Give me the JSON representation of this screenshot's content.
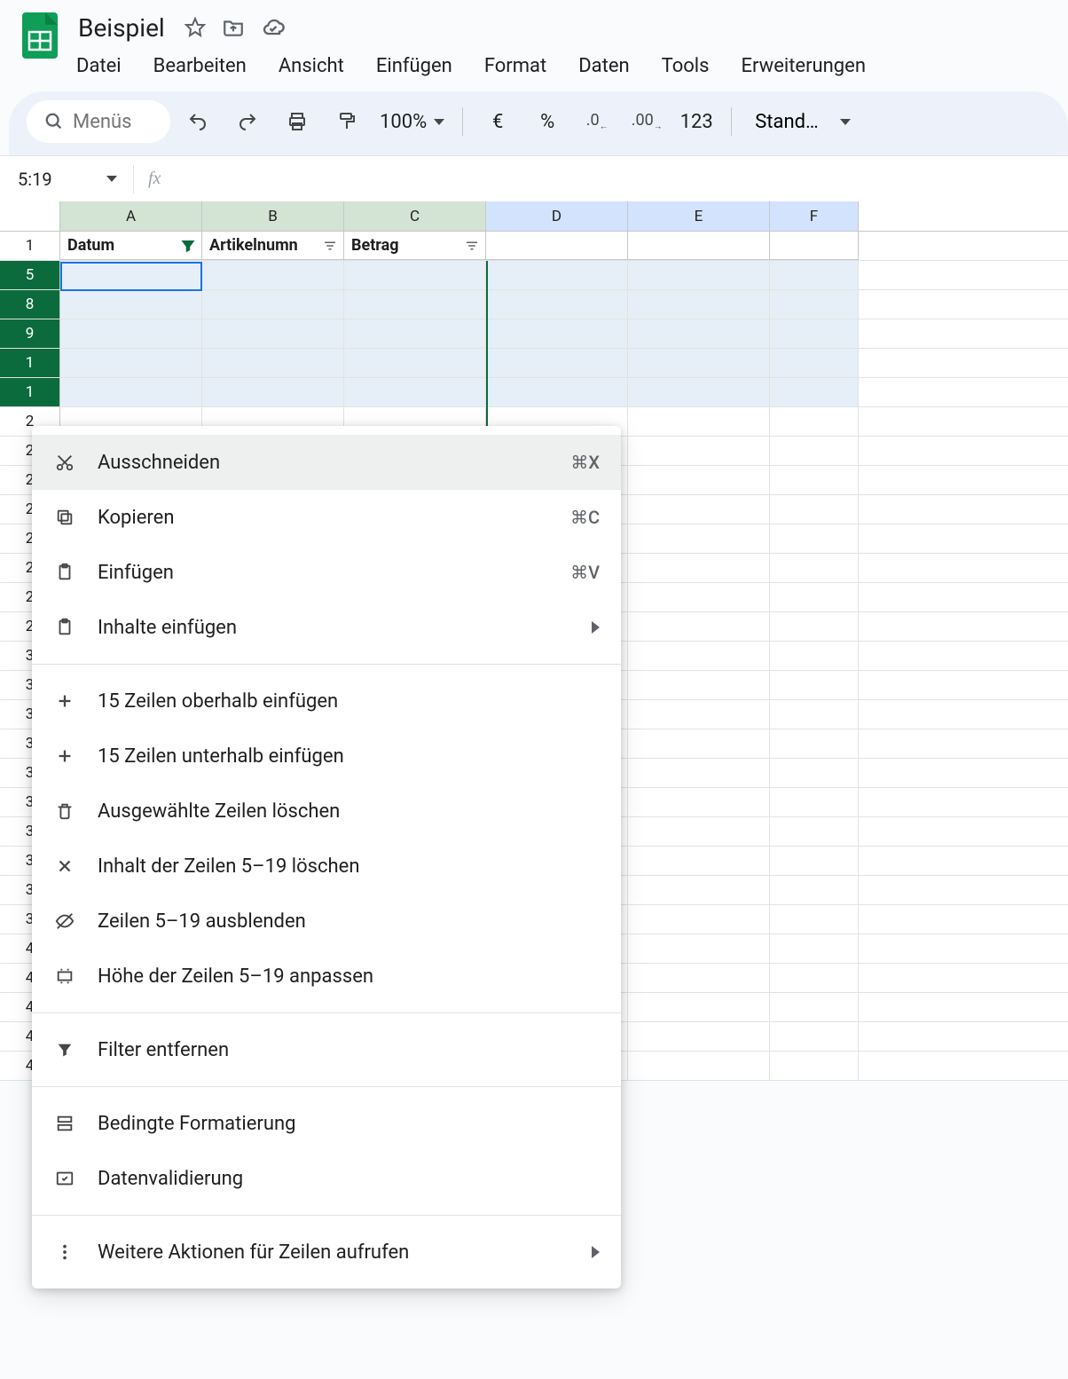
{
  "header": {
    "title": "Beispiel",
    "menu": [
      "Datei",
      "Bearbeiten",
      "Ansicht",
      "Einfügen",
      "Format",
      "Daten",
      "Tools",
      "Erweiterungen"
    ]
  },
  "toolbar": {
    "search_placeholder": "Menüs",
    "zoom": "100%",
    "currency": "€",
    "percent": "%",
    "dec_dec": ".0",
    "dec_inc": ".00",
    "numfmt": "123",
    "font": "Stand…"
  },
  "namebox": "5:19",
  "columns": [
    "A",
    "B",
    "C",
    "D",
    "E",
    "F"
  ],
  "header_cells": {
    "A": "Datum",
    "B": "Artikelnumn",
    "C": "Betrag"
  },
  "selected_row_heads": [
    "1",
    "5",
    "8",
    "9",
    "1",
    "1"
  ],
  "remaining_row_heads": [
    "2",
    "2",
    "2",
    "2",
    "2",
    "2",
    "2",
    "2",
    "3",
    "3",
    "3",
    "3",
    "3",
    "3",
    "3",
    "3",
    "3",
    "3",
    "4",
    "4",
    "4",
    "4",
    "4"
  ],
  "ctx": {
    "items": [
      {
        "icon": "cut",
        "label": "Ausschneiden",
        "short": "⌘X",
        "hover": true
      },
      {
        "icon": "copy",
        "label": "Kopieren",
        "short": "⌘C"
      },
      {
        "icon": "paste",
        "label": "Einfügen",
        "short": "⌘V"
      },
      {
        "icon": "paste",
        "label": "Inhalte einfügen",
        "submenu": true
      },
      {
        "sep": true
      },
      {
        "icon": "plus",
        "label": "15 Zeilen oberhalb einfügen"
      },
      {
        "icon": "plus",
        "label": "15 Zeilen unterhalb einfügen"
      },
      {
        "icon": "trash",
        "label": "Ausgewählte Zeilen löschen"
      },
      {
        "icon": "x",
        "label": "Inhalt der Zeilen 5–19 löschen"
      },
      {
        "icon": "hide",
        "label": "Zeilen 5–19 ausblenden"
      },
      {
        "icon": "resize",
        "label": "Höhe der Zeilen 5–19 anpassen"
      },
      {
        "sep": true
      },
      {
        "icon": "filter",
        "label": "Filter entfernen"
      },
      {
        "sep": true
      },
      {
        "icon": "condfmt",
        "label": "Bedingte Formatierung"
      },
      {
        "icon": "dataval",
        "label": "Datenvalidierung"
      },
      {
        "sep": true
      },
      {
        "icon": "dots",
        "label": "Weitere Aktionen für Zeilen aufrufen",
        "submenu": true
      }
    ]
  }
}
